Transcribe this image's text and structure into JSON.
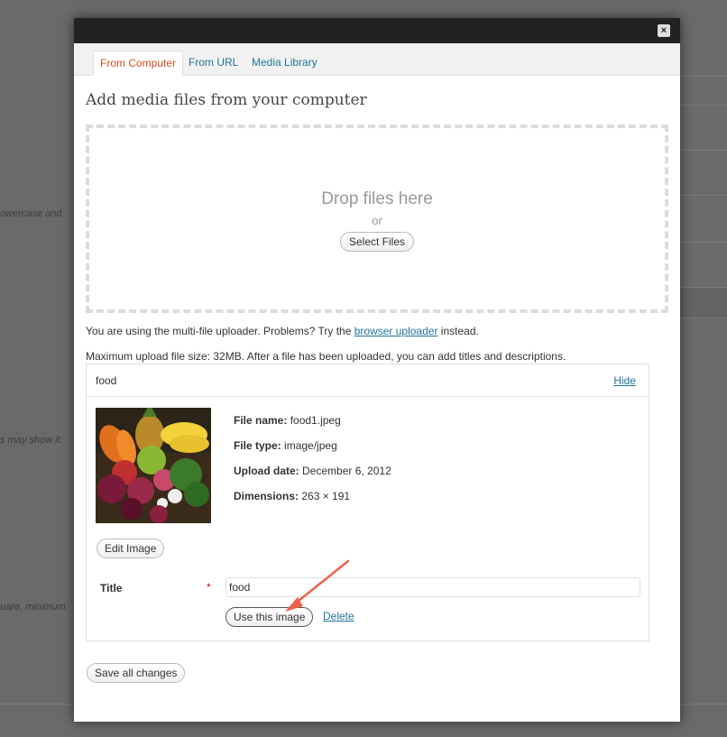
{
  "background": {
    "snippets": [
      "owercase and",
      "s may show it.",
      "uare, minimum"
    ]
  },
  "modal": {
    "close_label": "×",
    "tabs": [
      {
        "label": "From Computer"
      },
      {
        "label": "From URL"
      },
      {
        "label": "Media Library"
      }
    ],
    "heading": "Add media files from your computer",
    "dropzone": {
      "title": "Drop files here",
      "or": "or",
      "select_label": "Select Files"
    },
    "uploader_info": {
      "prefix": "You are using the multi-file uploader. Problems? Try the",
      "link": "browser uploader",
      "suffix": "instead."
    },
    "max_upload": "Maximum upload file size: 32MB. After a file has been uploaded, you can add titles and descriptions.",
    "item": {
      "name": "food",
      "hide_label": "Hide",
      "file_name_label": "File name:",
      "file_name": "food1.jpeg",
      "file_type_label": "File type:",
      "file_type": "image/jpeg",
      "upload_date_label": "Upload date:",
      "upload_date": "December 6, 2012",
      "dimensions_label": "Dimensions:",
      "dimensions": "263 × 191",
      "edit_image_label": "Edit Image",
      "title_label": "Title",
      "required_mark": "*",
      "title_value": "food",
      "use_image_label": "Use this image",
      "delete_label": "Delete"
    },
    "save_all_label": "Save all changes"
  },
  "colors": {
    "link": "#21759b",
    "active_tab": "#d54e21",
    "arrow": "#e8624a"
  }
}
